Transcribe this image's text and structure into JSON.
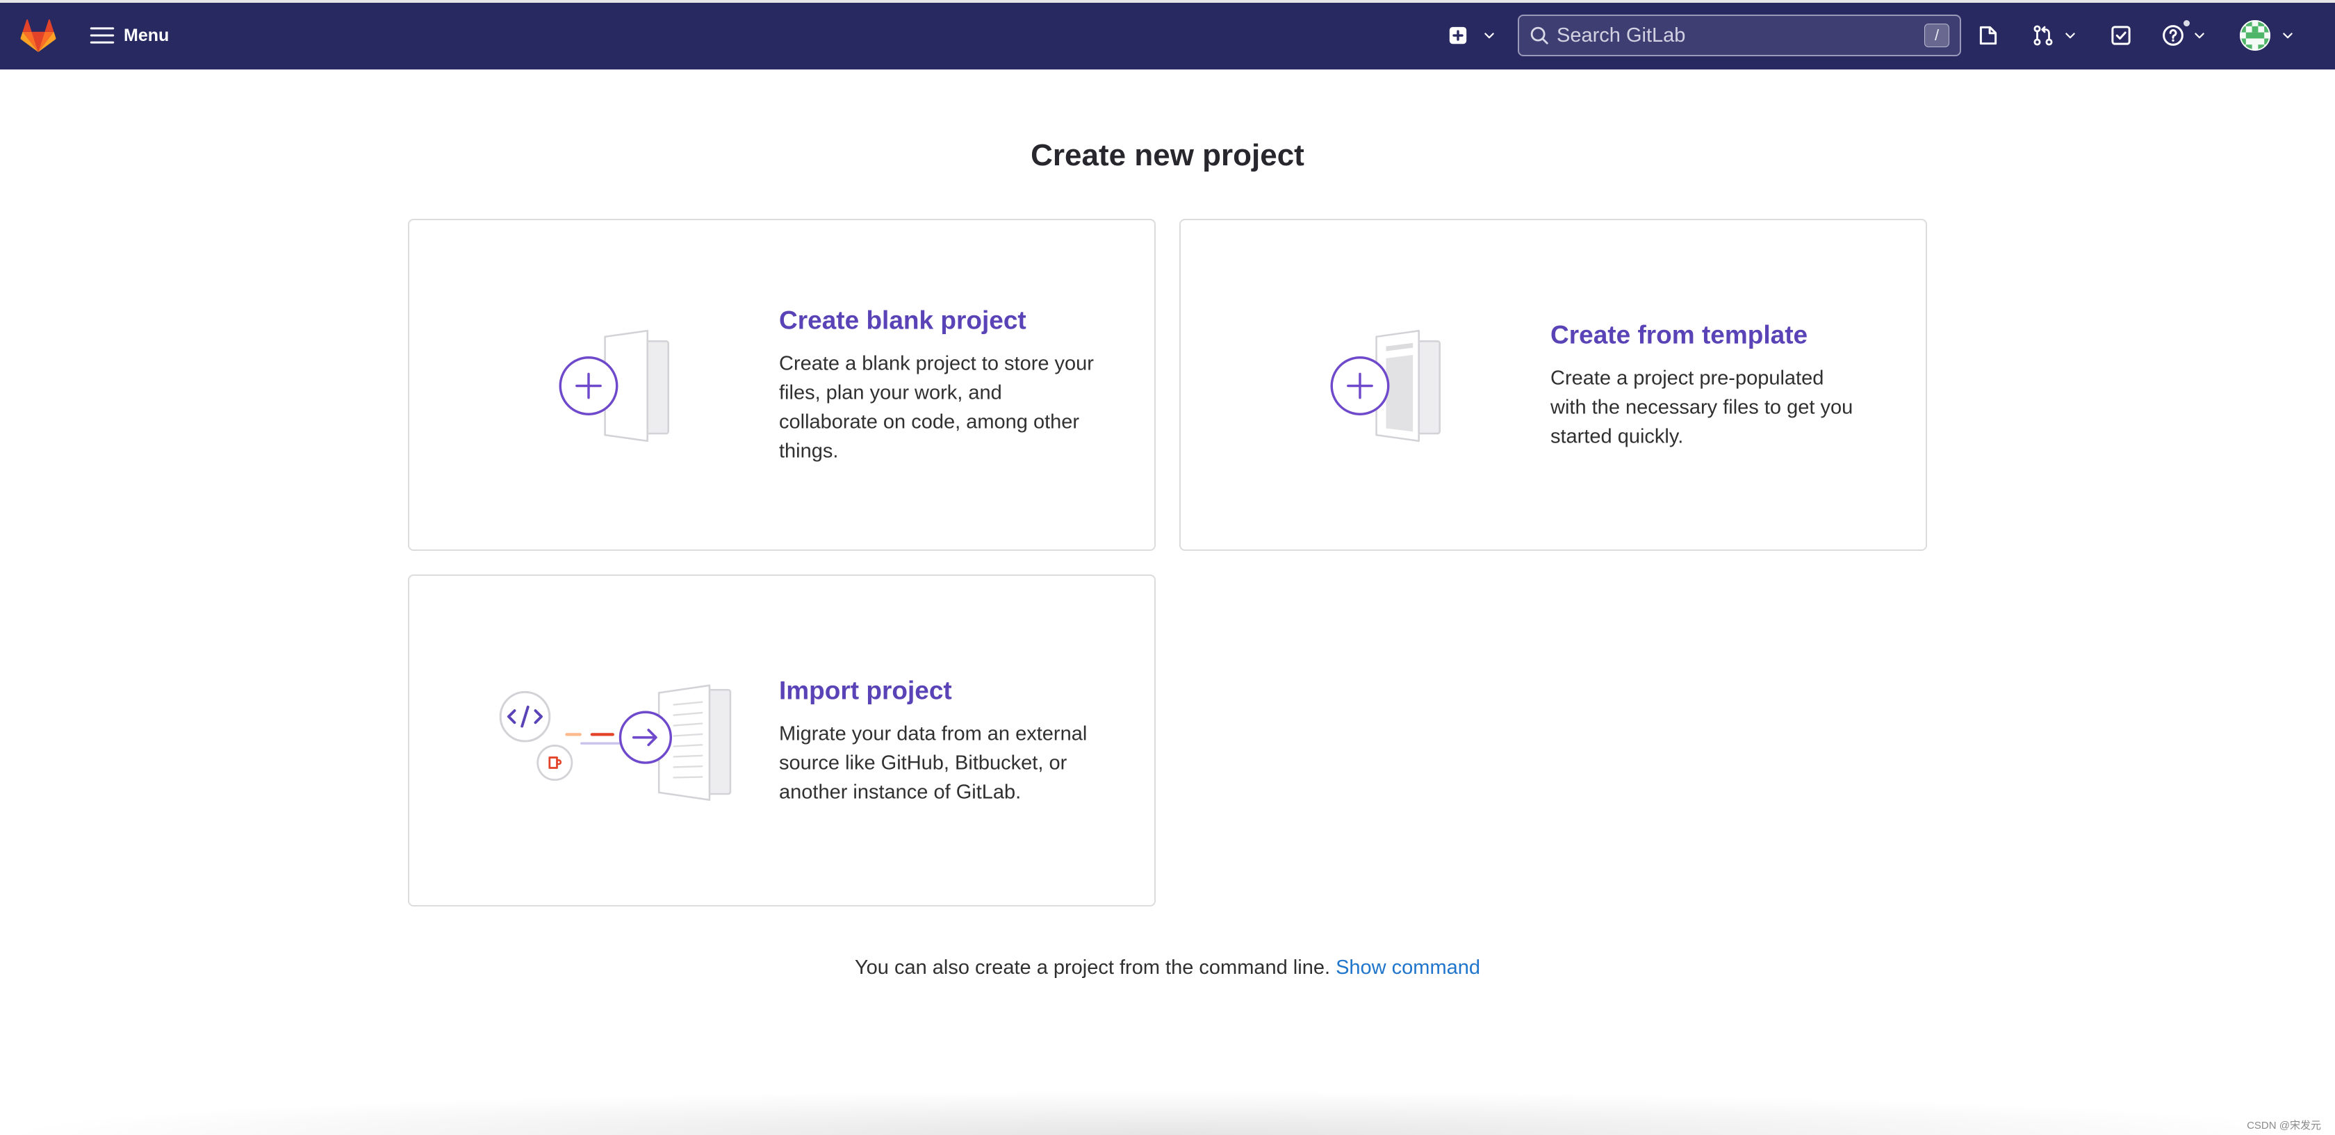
{
  "header": {
    "menu_label": "Menu",
    "search": {
      "placeholder": "Search GitLab",
      "shortcut": "/"
    },
    "icons": {
      "logo": "gitlab-logo",
      "menu": "hamburger-icon",
      "new": "plus-square-icon",
      "dropdown": "chevron-down-icon",
      "search": "search-icon",
      "issues": "issues-icon",
      "merge_requests": "merge-request-icon",
      "todos": "todo-icon",
      "help": "help-icon",
      "user": "avatar"
    }
  },
  "page": {
    "title": "Create new project"
  },
  "cards": [
    {
      "title": "Create blank project",
      "icon": "blank-project-illustration",
      "description_lines": [
        "Create a blank project to store your",
        "files, plan your work, and",
        "collaborate on code, among other",
        "things."
      ]
    },
    {
      "title": "Create from template",
      "icon": "template-project-illustration",
      "description_lines": [
        "Create a project pre-populated",
        "with the necessary files to get you",
        "started quickly."
      ]
    },
    {
      "title": "Import project",
      "icon": "import-project-illustration",
      "description_lines": [
        "Migrate your data from an external",
        "source like GitHub, Bitbucket, or",
        "another instance of GitLab."
      ]
    }
  ],
  "footer": {
    "text": "You can also create a project from the command line.",
    "link_label": "Show command"
  },
  "watermark": "CSDN @宋发元",
  "colors": {
    "header_bg": "#292961",
    "card_title": "#5943b6",
    "illustration_accent": "#6e49cb",
    "link": "#1f75cb",
    "card_border": "#dcdcde",
    "orange": "#e24329"
  }
}
